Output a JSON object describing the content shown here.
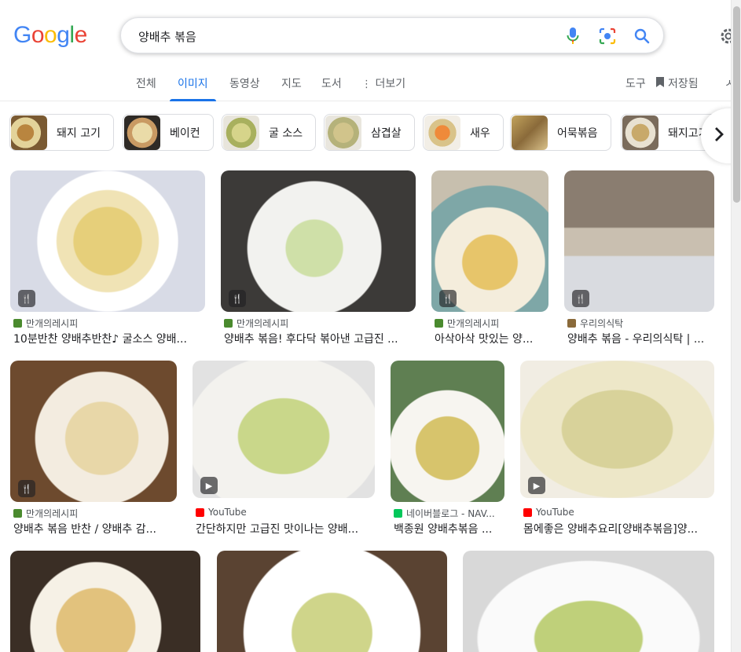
{
  "logo": {
    "text": "Google"
  },
  "search": {
    "query": "양배추 볶음"
  },
  "tabs": [
    {
      "label": "전체"
    },
    {
      "label": "이미지"
    },
    {
      "label": "동영상"
    },
    {
      "label": "지도"
    },
    {
      "label": "도서"
    },
    {
      "label": "더보기"
    }
  ],
  "tools": {
    "tools_label": "도구",
    "saved_label": "저장됨"
  },
  "chips": [
    {
      "label": "돼지 고기"
    },
    {
      "label": "베이컨"
    },
    {
      "label": "굴 소스"
    },
    {
      "label": "삼겹살"
    },
    {
      "label": "새우"
    },
    {
      "label": "어묵볶음"
    },
    {
      "label": "돼지고기"
    }
  ],
  "results": [
    {
      "source": "만개의레시피",
      "title": "10분반찬 양배추반찬♪ 굴소스 양배..."
    },
    {
      "source": "만개의레시피",
      "title": "양배추 볶음! 후다닥 볶아낸 고급진 ..."
    },
    {
      "source": "만개의레시피",
      "title": "아삭아삭 맛있는 양..."
    },
    {
      "source": "우리의식탁",
      "title": "양배추 볶음 - 우리의식탁 | ..."
    },
    {
      "source": "만개의레시피",
      "title": "양배추 볶음 반찬 / 양배추 감..."
    },
    {
      "source": "YouTube",
      "title": "간단하지만 고급진 맛이나는 양배..."
    },
    {
      "source": "네이버블로그 - NAV...",
      "title": "백종원 양배추볶음 ..."
    },
    {
      "source": "YouTube",
      "title": "몸에좋은 양배추요리[양배추볶음]양..."
    }
  ]
}
